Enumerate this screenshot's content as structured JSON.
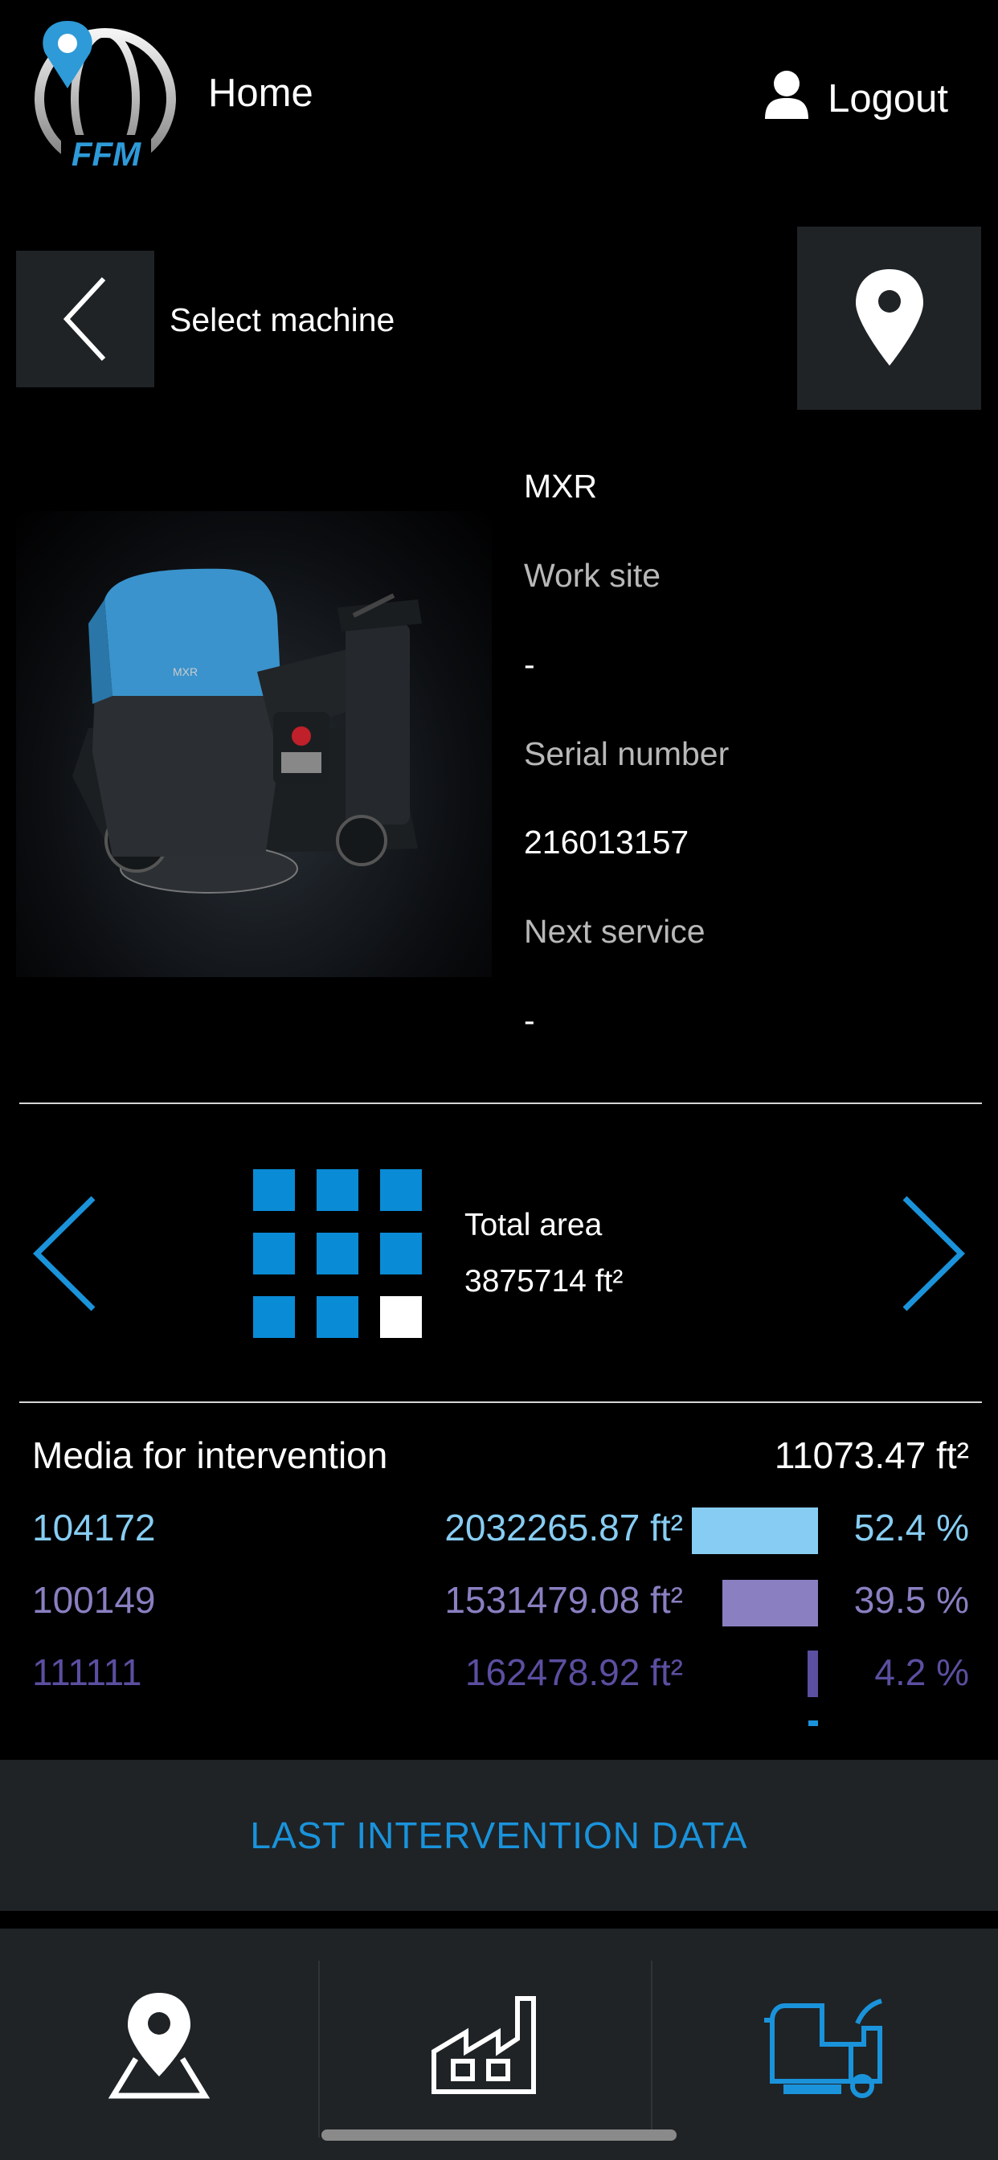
{
  "header": {
    "logo_text": "FFM",
    "home_label": "Home",
    "logout_label": "Logout"
  },
  "toolbar": {
    "select_label": "Select machine"
  },
  "machine": {
    "model": "MXR",
    "work_site_label": "Work site",
    "work_site_value": "-",
    "serial_label": "Serial number",
    "serial_value": "216013157",
    "next_service_label": "Next service",
    "next_service_value": "-"
  },
  "area": {
    "label": "Total area",
    "value": "3875714 ft²"
  },
  "media": {
    "title": "Media for intervention",
    "total": "11073.47 ft²",
    "rows": [
      {
        "id": "104172",
        "value": "2032265.87 ft²",
        "percent": "52.4 %",
        "share": 0.524,
        "color": "#87cdf3"
      },
      {
        "id": "100149",
        "value": "1531479.08 ft²",
        "percent": "39.5 %",
        "share": 0.395,
        "color": "#8a7fc1"
      },
      {
        "id": "111111",
        "value": "162478.92 ft²",
        "percent": "4.2 %",
        "share": 0.042,
        "color": "#5a4fa0"
      }
    ]
  },
  "last_intervention_label": "LAST INTERVENTION DATA",
  "colors": {
    "accent": "#1a93db",
    "panel": "#1f2326",
    "grid_blue": "#0a8bd6"
  }
}
